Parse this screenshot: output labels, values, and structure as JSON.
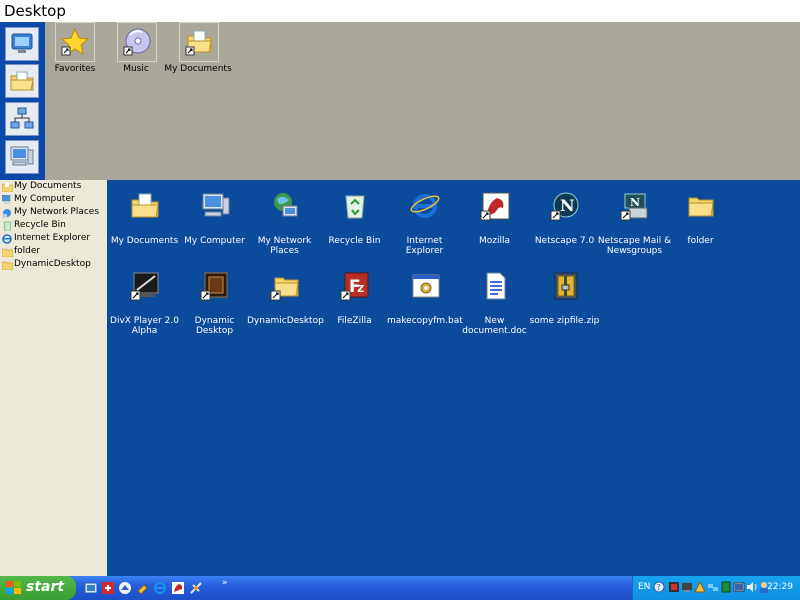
{
  "window": {
    "title": "Desktop"
  },
  "top_shortcuts": [
    {
      "label": "Favorites",
      "icon": "star-icon"
    },
    {
      "label": "Music",
      "icon": "cd-icon"
    },
    {
      "label": "My Documents",
      "icon": "folder-docs-icon"
    }
  ],
  "quick_launch_side": [
    {
      "icon": "display-icon"
    },
    {
      "icon": "folder-docs-icon"
    },
    {
      "icon": "network-icon"
    },
    {
      "icon": "computer-icon"
    }
  ],
  "tree": {
    "items": [
      {
        "label": "My Documents",
        "icon": "folder-docs-icon"
      },
      {
        "label": "My Computer",
        "icon": "computer-icon"
      },
      {
        "label": "My Network Places",
        "icon": "network-icon"
      },
      {
        "label": "Recycle Bin",
        "icon": "recycle-bin-icon"
      },
      {
        "label": "Internet Explorer",
        "icon": "ie-icon"
      },
      {
        "label": "folder",
        "icon": "folder-icon"
      },
      {
        "label": "DynamicDesktop",
        "icon": "folder-icon"
      }
    ]
  },
  "desktop": {
    "icons": [
      {
        "label": "My Documents",
        "icon": "folder-docs-icon"
      },
      {
        "label": "My Computer",
        "icon": "computer-icon"
      },
      {
        "label": "My Network Places",
        "icon": "network-icon"
      },
      {
        "label": "Recycle Bin",
        "icon": "recycle-bin-icon"
      },
      {
        "label": "Internet Explorer",
        "icon": "ie-icon"
      },
      {
        "label": "Mozilla",
        "icon": "mozilla-icon"
      },
      {
        "label": "Netscape 7.0",
        "icon": "netscape-icon"
      },
      {
        "label": "Netscape Mail & Newsgroups",
        "icon": "netscape-mail-icon"
      },
      {
        "label": "folder",
        "icon": "folder-icon"
      },
      {
        "label": "DivX Player 2.0 Alpha",
        "icon": "divx-icon"
      },
      {
        "label": "Dynamic Desktop",
        "icon": "dynamic-desktop-icon"
      },
      {
        "label": "DynamicDesktop",
        "icon": "folder-icon"
      },
      {
        "label": "FileZilla",
        "icon": "filezilla-icon"
      },
      {
        "label": "makecopyfm.bat",
        "icon": "bat-file-icon"
      },
      {
        "label": "New document.doc",
        "icon": "doc-file-icon"
      },
      {
        "label": "some zipfile.zip",
        "icon": "zip-file-icon"
      }
    ]
  },
  "taskbar": {
    "start_label": "start",
    "chevron": "»",
    "language": "EN",
    "clock": "22:29"
  },
  "colors": {
    "desktop_bg": "#0a4b9b",
    "top_region_bg": "#aaa79b",
    "tree_bg": "#ece9d8",
    "taskbar": "#245edb",
    "start_green": "#3a9e32",
    "tray": "#0f8ee0"
  }
}
